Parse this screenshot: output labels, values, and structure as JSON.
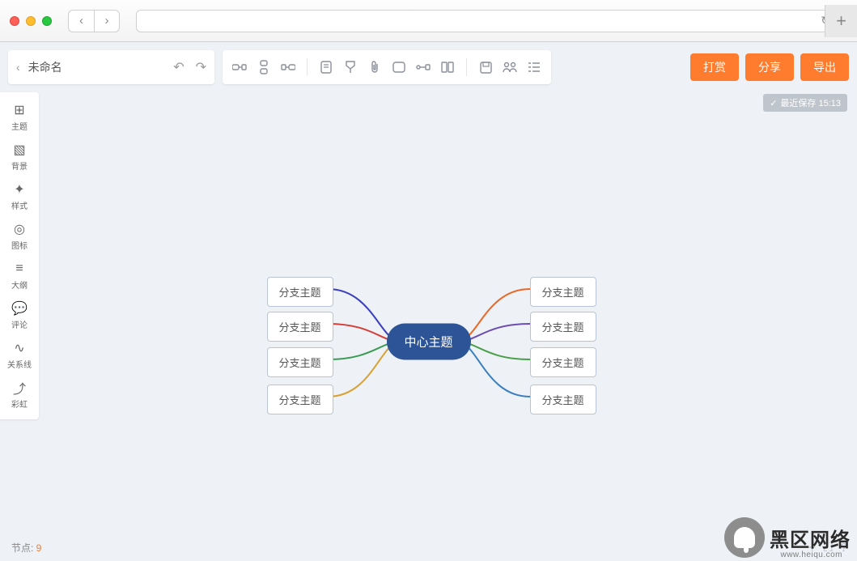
{
  "browser": {
    "url": ""
  },
  "title_bar": {
    "back_icon": "‹",
    "title": "未命名",
    "undo_icon": "↶",
    "redo_icon": "↷"
  },
  "toolbar_groups": {
    "group1": [
      {
        "name": "add-child-icon"
      },
      {
        "name": "add-sibling-icon"
      },
      {
        "name": "add-parent-icon"
      }
    ],
    "group2": [
      {
        "name": "note-icon"
      },
      {
        "name": "task-icon"
      },
      {
        "name": "attachment-icon"
      },
      {
        "name": "boundary-icon"
      },
      {
        "name": "relation-icon"
      },
      {
        "name": "summary-icon"
      }
    ],
    "group3": [
      {
        "name": "save-icon"
      },
      {
        "name": "collaborate-icon"
      },
      {
        "name": "outline-view-icon"
      }
    ]
  },
  "actions": {
    "print": "打赏",
    "share": "分享",
    "export": "导出"
  },
  "save_status": {
    "label": "最近保存 15:13",
    "icon": "✓"
  },
  "sidebar": {
    "items": [
      {
        "icon": "grid",
        "label": "主题"
      },
      {
        "icon": "image",
        "label": "背景"
      },
      {
        "icon": "wand",
        "label": "样式"
      },
      {
        "icon": "target",
        "label": "图标"
      },
      {
        "icon": "list",
        "label": "大纲"
      },
      {
        "icon": "chat",
        "label": "评论"
      },
      {
        "icon": "link",
        "label": "关系线"
      },
      {
        "icon": "export",
        "label": "彩虹"
      }
    ]
  },
  "mindmap": {
    "center": "中心主题",
    "branches": {
      "left": [
        "分支主题",
        "分支主题",
        "分支主题",
        "分支主题"
      ],
      "right": [
        "分支主题",
        "分支主题",
        "分支主题",
        "分支主题"
      ]
    },
    "colors": {
      "left": [
        "#3a3fbf",
        "#d43f3a",
        "#3b9b55",
        "#d8a233"
      ],
      "right": [
        "#e86a2a",
        "#6c4db1",
        "#4aa04a",
        "#3a7fbf"
      ]
    }
  },
  "footer": {
    "label": "节点: ",
    "count": "9"
  },
  "watermark": {
    "title": "黑区网络",
    "url": "www.heiqu.com"
  }
}
